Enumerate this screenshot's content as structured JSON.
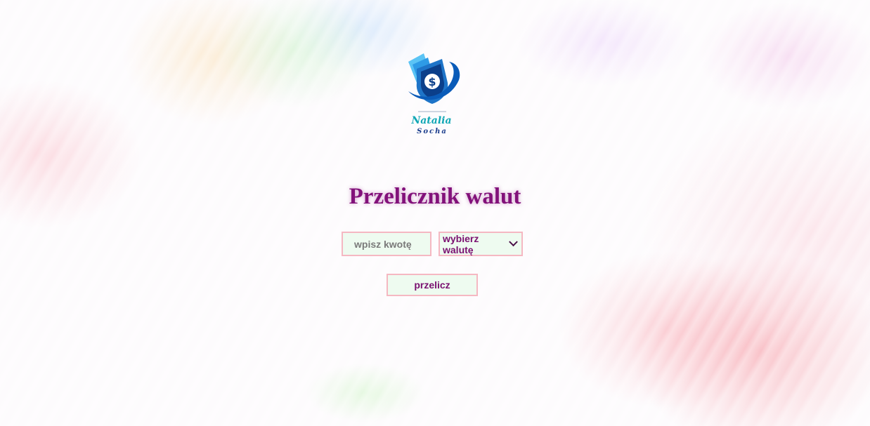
{
  "logo": {
    "icon": "dollar-shield-logo",
    "line1": "Natalia",
    "line2": "Socha"
  },
  "page": {
    "title": "Przelicznik walut"
  },
  "form": {
    "amount_placeholder": "wpisz kwotę",
    "amount_value": "",
    "currency_selected": "wybierz walutę",
    "currency_icon": "chevron-down-icon",
    "convert_label": "przelicz"
  },
  "colors": {
    "title": "#82117a",
    "field_border": "#f5b8c2",
    "field_background": "#eefbf0",
    "logo_blue": "#1a3c8c",
    "logo_teal": "#10a7b5"
  }
}
